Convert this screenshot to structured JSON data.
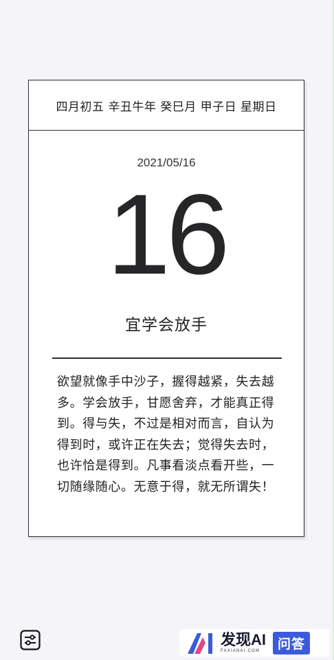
{
  "calendar": {
    "lunar_line": "四月初五 辛丑牛年 癸巳月 甲子日 星期日",
    "date": "2021/05/16",
    "day": "16",
    "motto": "宜学会放手",
    "quote": "欲望就像手中沙子，握得越紧，失去越多。学会放手，甘愿舍弃，才能真正得到。得与失，不过是相对而言，自认为得到时，或许正在失去；觉得失去时，也许恰是得到。凡事看淡点看开些，一切随缘随心。无意于得，就无所谓失！"
  },
  "toolbar": {
    "settings_icon": "sliders-icon"
  },
  "watermark": {
    "name": "发现AI",
    "domain": "FAXIANAI.COM",
    "badge": "问答",
    "logo_colors": {
      "primary": "#3b5bdb",
      "accent": "#e0458a"
    }
  }
}
